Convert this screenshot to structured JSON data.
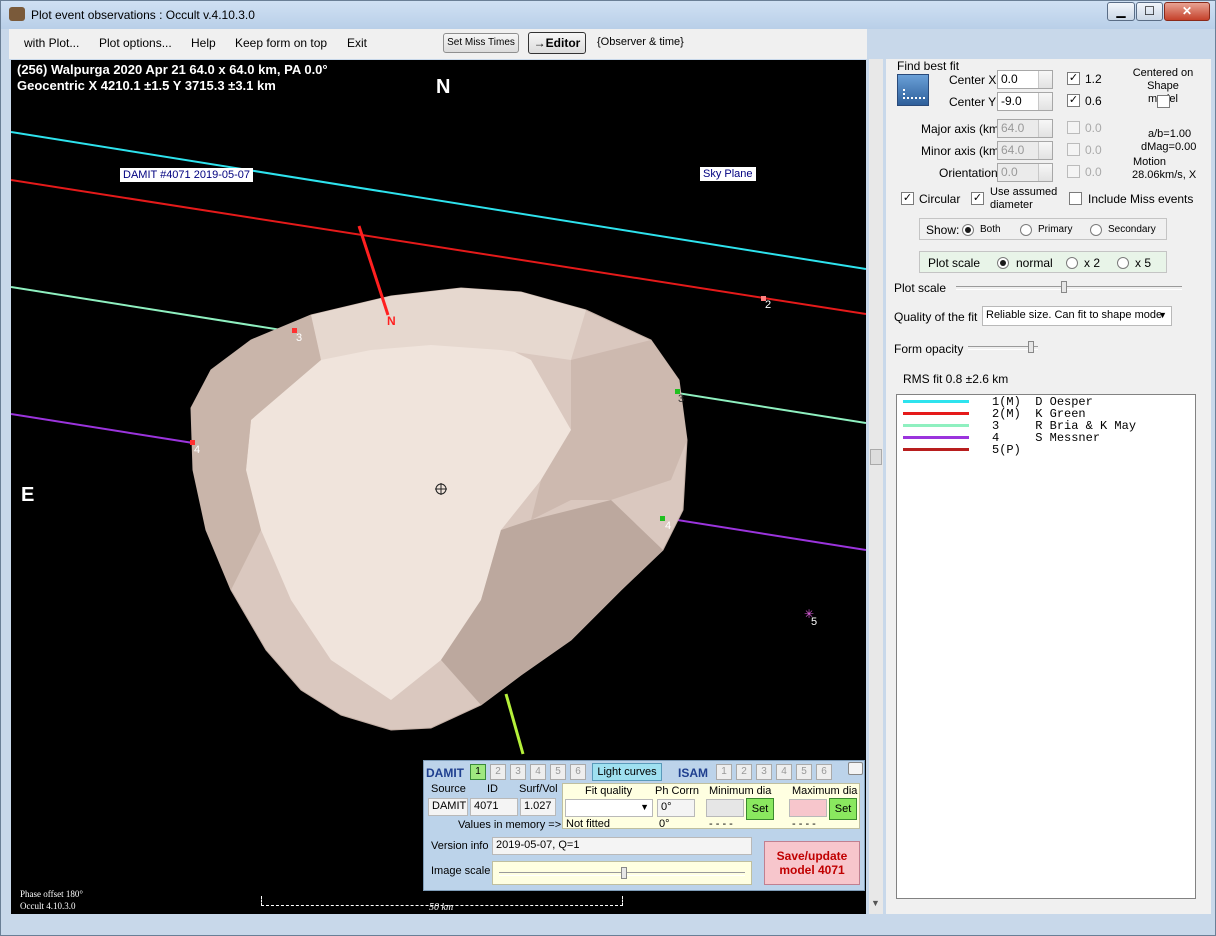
{
  "window": {
    "title": "Plot event observations : Occult v.4.10.3.0",
    "close": "✕"
  },
  "menu": {
    "items": [
      "with Plot...",
      "Plot options...",
      "Help",
      "Keep form on top",
      "Exit"
    ],
    "set_miss_times": "Set Miss Times",
    "editor": "→Editor",
    "observer_time": "{Observer & time}"
  },
  "plot": {
    "info_line1": "(256) Walpurga  2020 Apr 21  64.0 x 64.0 km,  PA 0.0°",
    "info_line2": "Geocentric  X  4210.1 ±1.5  Y 3715.3 ±3.1 km",
    "north": "N",
    "east": "E",
    "model_label": "DAMIT #4071 2019-05-07",
    "sky_plane": "Sky Plane",
    "pole_label": "N",
    "chord_labels": [
      "2",
      "3",
      "3",
      "4",
      "4",
      "5"
    ],
    "phase_offset": "Phase offset 180°",
    "version": "Occult 4.10.3.0",
    "scale_label": "50 km",
    "chord_colors": [
      "#2ee3ee",
      "#e51a1a",
      "#8ff0c0",
      "#9b34dd",
      "#b81e1e"
    ]
  },
  "damit": {
    "title": "DAMIT",
    "models": [
      "1",
      "2",
      "3",
      "4",
      "5",
      "6"
    ],
    "light_curves": "Light curves",
    "isam": "ISAM",
    "isam_models": [
      "1",
      "2",
      "3",
      "4",
      "5",
      "6"
    ],
    "source_label": "Source",
    "id_label": "ID",
    "surf_vol_label": "Surf/Vol",
    "source": "DAMIT",
    "id": "4071",
    "surf_vol": "1.027",
    "values_in_memory": "Values in memory =>",
    "fit_quality_label": "Fit quality",
    "ph_corr_label": "Ph Corrn",
    "ph_corr": "0°",
    "min_dia_label": "Minimum dia",
    "max_dia_label": "Maximum dia",
    "set": "Set",
    "not_fitted": "Not fitted",
    "ph_corr_value": "0°",
    "min_dashes": "- - - -",
    "max_dashes": "- - - -",
    "version_info_label": "Version info",
    "version_info": "2019-05-07, Q=1",
    "image_scale_label": "Image scale",
    "save_line1": "Save/update",
    "save_line2": "model 4071"
  },
  "fit": {
    "find_best_fit": "Find best fit",
    "center_x_label": "Center X",
    "center_x": "0.0",
    "center_y_label": "Center Y",
    "center_y": "-9.0",
    "cx_step": "1.2",
    "cy_step": "0.6",
    "centered_label": "Centered on Shape model",
    "major_label": "Major axis (km)",
    "major": "64.0",
    "major_step": "0.0",
    "minor_label": "Minor axis (km)",
    "minor": "64.0",
    "minor_step": "0.0",
    "orientation_label": "Orientation",
    "orientation": "0.0",
    "orient_step": "0.0",
    "ab_ratio": "a/b=1.00",
    "dmag": "dMag=0.00",
    "motion_label": "Motion",
    "motion": "28.06km/s, X",
    "circular": "Circular",
    "use_assumed": "Use assumed",
    "diameter": "diameter",
    "include_miss": "Include Miss events",
    "show_label": "Show:",
    "show_both": "Both",
    "show_primary": "Primary",
    "show_secondary": "Secondary",
    "plot_scale_label": "Plot scale",
    "scale_normal": "normal",
    "scale_x2": "x 2",
    "scale_x5": "x 5",
    "plot_scale_slider_label": "Plot scale",
    "quality_label": "Quality of the fit",
    "quality_value": "Reliable size. Can fit to shape mode",
    "form_opacity_label": "Form opacity",
    "rms_fit": "RMS fit  0.8 ±2.6 km"
  },
  "legend": {
    "rows": [
      {
        "id": "1(M)",
        "name": "D Oesper"
      },
      {
        "id": "2(M)",
        "name": "K Green"
      },
      {
        "id": "3",
        "name": "R Bria & K May"
      },
      {
        "id": "4",
        "name": "S Messner"
      },
      {
        "id": "5(P)",
        "name": ""
      }
    ]
  }
}
